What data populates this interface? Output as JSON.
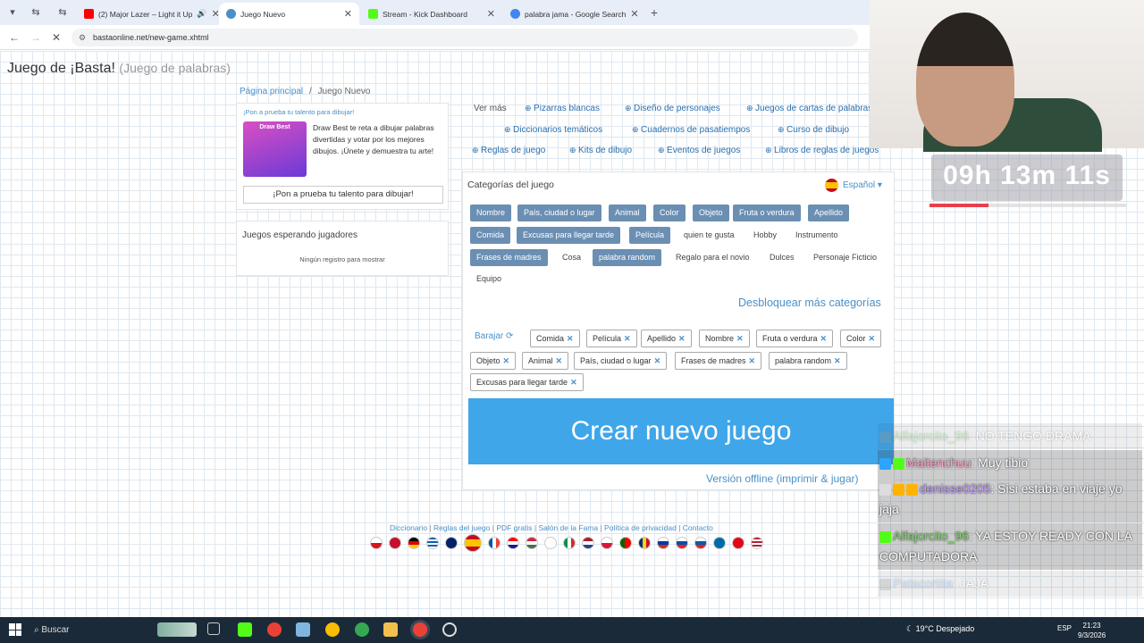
{
  "browser": {
    "tabs": [
      {
        "label": "(2) Major Lazer – Light it Up",
        "color": "#ff0000"
      },
      {
        "label": "Juego Nuevo",
        "color": "#4a90c8"
      },
      {
        "label": "Stream - Kick Dashboard",
        "color": "#53fc18"
      },
      {
        "label": "palabra jama - Google Search",
        "color": "#4285f4"
      }
    ],
    "url": "bastaonline.net/new-game.xhtml"
  },
  "site": {
    "title": "Juego de ¡Basta!",
    "subtitle": "(Juego de palabras)"
  },
  "breadcrumb": {
    "home": "Página principal",
    "sep": "/",
    "current": "Juego Nuevo"
  },
  "promo": {
    "heading": "¡Pon a prueba tu talento para dibujar!",
    "image_text": "Draw Best",
    "description": "Draw Best te reta a dibujar palabras divertidas y votar por los mejores dibujos. ¡Únete y demuestra tu arte!",
    "button": "¡Pon a prueba tu talento para dibujar!"
  },
  "waiting": {
    "heading": "Juegos esperando jugadores",
    "empty": "Ningún registro para mostrar"
  },
  "links": {
    "ver_mas": "Ver más",
    "items": [
      "Pizarras blancas",
      "Diseño de personajes",
      "Juegos de cartas de palabras",
      "Diccionarios temáticos",
      "Cuadernos de pasatiempos",
      "Curso de dibujo",
      "Reglas de juego",
      "Kits de dibujo",
      "Eventos de juegos",
      "Libros de reglas de juegos"
    ]
  },
  "categories": {
    "heading": "Categorías del juego",
    "language": "Español",
    "chips": [
      {
        "label": "Nombre",
        "on": true
      },
      {
        "label": "País, ciudad o lugar",
        "on": true
      },
      {
        "label": "Animal",
        "on": true
      },
      {
        "label": "Color",
        "on": true
      },
      {
        "label": "Objeto",
        "on": true
      },
      {
        "label": "Fruta o verdura",
        "on": true
      },
      {
        "label": "Apellido",
        "on": true
      },
      {
        "label": "Comida",
        "on": true
      },
      {
        "label": "Excusas para llegar tarde",
        "on": true
      },
      {
        "label": "Película",
        "on": true
      },
      {
        "label": "quien te gusta",
        "on": false
      },
      {
        "label": "Hobby",
        "on": false
      },
      {
        "label": "Instrumento",
        "on": false
      },
      {
        "label": "Frases de madres",
        "on": true
      },
      {
        "label": "Cosa",
        "on": false
      },
      {
        "label": "palabra random",
        "on": true
      },
      {
        "label": "Regalo para el novio",
        "on": false
      },
      {
        "label": "Dulces",
        "on": false
      },
      {
        "label": "Personaje Ficticio",
        "on": false
      },
      {
        "label": "Equipo",
        "on": false
      }
    ],
    "unlock": "Desbloquear más categorías",
    "shuffle": "Barajar",
    "selected": [
      "Comida",
      "Película",
      "Apellido",
      "Nombre",
      "Fruta o verdura",
      "Color",
      "Objeto",
      "Animal",
      "País, ciudad o lugar",
      "Frases de madres",
      "palabra random",
      "Excusas para llegar tarde"
    ],
    "create": "Crear nuevo juego",
    "offline": "Versión offline (imprimir & jugar)"
  },
  "footer": {
    "links": [
      "Diccionario",
      "Reglas del juego",
      "PDF gratis",
      "Salón de la Fama",
      "Política de privacidad",
      "Contacto"
    ]
  },
  "stream": {
    "timer": "09h 13m 11s",
    "progress": 0.3,
    "chat": [
      {
        "user": "Alfajorcito_96",
        "text": ": NO TENGO DRAMA",
        "color": "#7bd36b"
      },
      {
        "user": "Maitenchuu",
        "text": ": Muy tibio",
        "color": "#ff9ec7"
      },
      {
        "user": "denisse0205",
        "text": ": Sisi estaba en viaje yo jaja",
        "color": "#c49cff"
      },
      {
        "user": "Alfajorcito_96",
        "text": ": YA ESTOY READY CON LA COMPUTADORA",
        "color": "#7bd36b"
      },
      {
        "user": "Patacortita",
        "text": ": JAJA",
        "color": "#7ab8ff"
      }
    ]
  },
  "taskbar": {
    "search": "Buscar",
    "weather": "19°C Despejado",
    "lang": "ESP",
    "time": "21:23",
    "date": "9/3/2026"
  }
}
